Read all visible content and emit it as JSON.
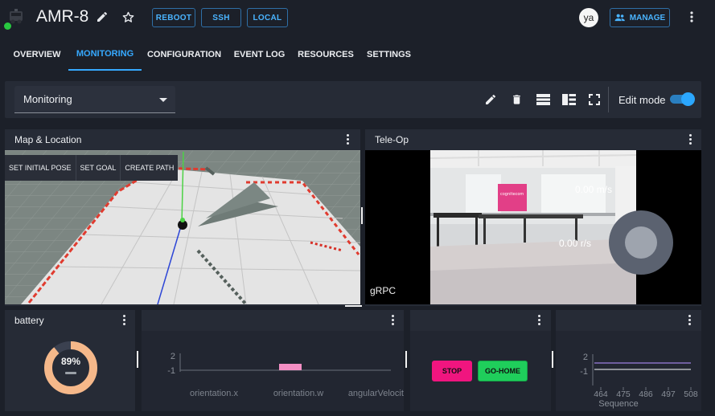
{
  "header": {
    "robot_name": "AMR-8",
    "buttons": {
      "reboot": "REBOOT",
      "ssh": "SSH",
      "local": "LOCAL"
    },
    "user_initials": "ya",
    "manage_label": "MANAGE",
    "status_color": "#28c840",
    "accent_color": "#36a9ff"
  },
  "tabs": [
    {
      "label": "OVERVIEW",
      "active": false
    },
    {
      "label": "MONITORING",
      "active": true
    },
    {
      "label": "CONFIGURATION",
      "active": false
    },
    {
      "label": "EVENT LOG",
      "active": false
    },
    {
      "label": "RESOURCES",
      "active": false
    },
    {
      "label": "SETTINGS",
      "active": false
    }
  ],
  "toolbar": {
    "dashboard_select": "Monitoring",
    "edit_mode_label": "Edit mode",
    "edit_mode_on": true,
    "icons": [
      "pencil-icon",
      "trash-icon",
      "rows-layout-icon",
      "split-layout-icon",
      "fullscreen-icon"
    ]
  },
  "widgets": {
    "map": {
      "title": "Map & Location",
      "buttons": {
        "set_initial_pose": "SET INITIAL POSE",
        "set_goal": "SET GOAL",
        "create_path": "CREATE PATH"
      }
    },
    "teleop": {
      "title": "Tele-Op",
      "transport": "gRPC",
      "linear_speed": "0.00 m/s",
      "angular_speed": "0.00 r/s",
      "camera_logo_text": "cognitecom"
    },
    "battery": {
      "title": "battery",
      "percent": "89%",
      "level": 0.89,
      "ring_color": "#f5b88a"
    },
    "joint_chart": {
      "title": ""
    },
    "actions": {
      "stop_label": "STOP",
      "go_home_label": "GO-HOME",
      "stop_color": "#f0157f",
      "go_home_color": "#1fce5b"
    },
    "sequence_chart": {
      "title": ""
    }
  },
  "chart_data": [
    {
      "type": "bar",
      "categories": [
        "orientation.x",
        "orientation.w",
        "angularVelocity.y"
      ],
      "series": [
        {
          "values": [
            0,
            1,
            0
          ]
        }
      ],
      "yticks": [
        "2",
        "-1"
      ],
      "ylim": [
        -1,
        2
      ],
      "bar_color": "#f48fc4"
    },
    {
      "type": "line",
      "x": [
        464,
        475,
        486,
        497,
        508
      ],
      "xlabel": "Sequence",
      "yticks": [
        "2",
        "-1"
      ],
      "ylim": [
        -1,
        2
      ],
      "series": [
        {
          "values": [
            0,
            0,
            0,
            0,
            0
          ],
          "color": "#9b7fe0"
        },
        {
          "values": [
            -1,
            -1,
            -1,
            -1,
            -1
          ],
          "color": "#cfd2d8"
        }
      ]
    }
  ]
}
